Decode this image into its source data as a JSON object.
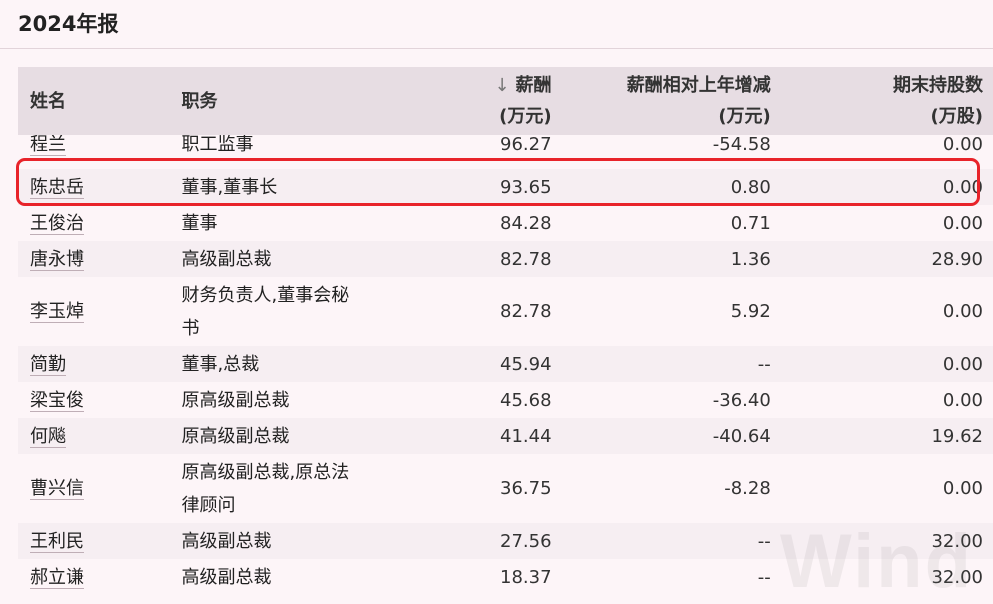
{
  "title": "2024年报",
  "watermark": "Wind",
  "table": {
    "headers": {
      "name": "姓名",
      "position": "职务",
      "salary_sort_icon": "↓",
      "salary_line1": "薪酬",
      "salary_line2": "(万元)",
      "change_line1": "薪酬相对上年增减",
      "change_line2": "(万元)",
      "shares_line1": "期末持股数",
      "shares_line2": "(万股)"
    },
    "rows": [
      {
        "name": "程兰",
        "position": "职工监事",
        "salary": "96.27",
        "change": "-54.58",
        "shares": "0.00"
      },
      {
        "name": "陈忠岳",
        "position": "董事,董事长",
        "salary": "93.65",
        "change": "0.80",
        "shares": "0.00"
      },
      {
        "name": "王俊治",
        "position": "董事",
        "salary": "84.28",
        "change": "0.71",
        "shares": "0.00"
      },
      {
        "name": "唐永博",
        "position": "高级副总裁",
        "salary": "82.78",
        "change": "1.36",
        "shares": "28.90"
      },
      {
        "name": "李玉焯",
        "position_line1": "财务负责人,董事会秘",
        "position_line2": "书",
        "salary": "82.78",
        "change": "5.92",
        "shares": "0.00"
      },
      {
        "name": "简勤",
        "position": "董事,总裁",
        "salary": "45.94",
        "change": "--",
        "shares": "0.00"
      },
      {
        "name": "梁宝俊",
        "position": "原高级副总裁",
        "salary": "45.68",
        "change": "-36.40",
        "shares": "0.00"
      },
      {
        "name": "何飚",
        "position": "原高级副总裁",
        "salary": "41.44",
        "change": "-40.64",
        "shares": "19.62"
      },
      {
        "name": "曹兴信",
        "position_line1": "原高级副总裁,原总法",
        "position_line2": "律顾问",
        "salary": "36.75",
        "change": "-8.28",
        "shares": "0.00"
      },
      {
        "name": "王利民",
        "position": "高级副总裁",
        "salary": "27.56",
        "change": "--",
        "shares": "32.00"
      },
      {
        "name": "郝立谦",
        "position": "高级副总裁",
        "salary": "18.37",
        "change": "--",
        "shares": "32.00"
      }
    ]
  },
  "colors": {
    "highlight": "#e8232a",
    "header_bg": "#e7dde3",
    "page_bg": "#fdf5f8"
  }
}
